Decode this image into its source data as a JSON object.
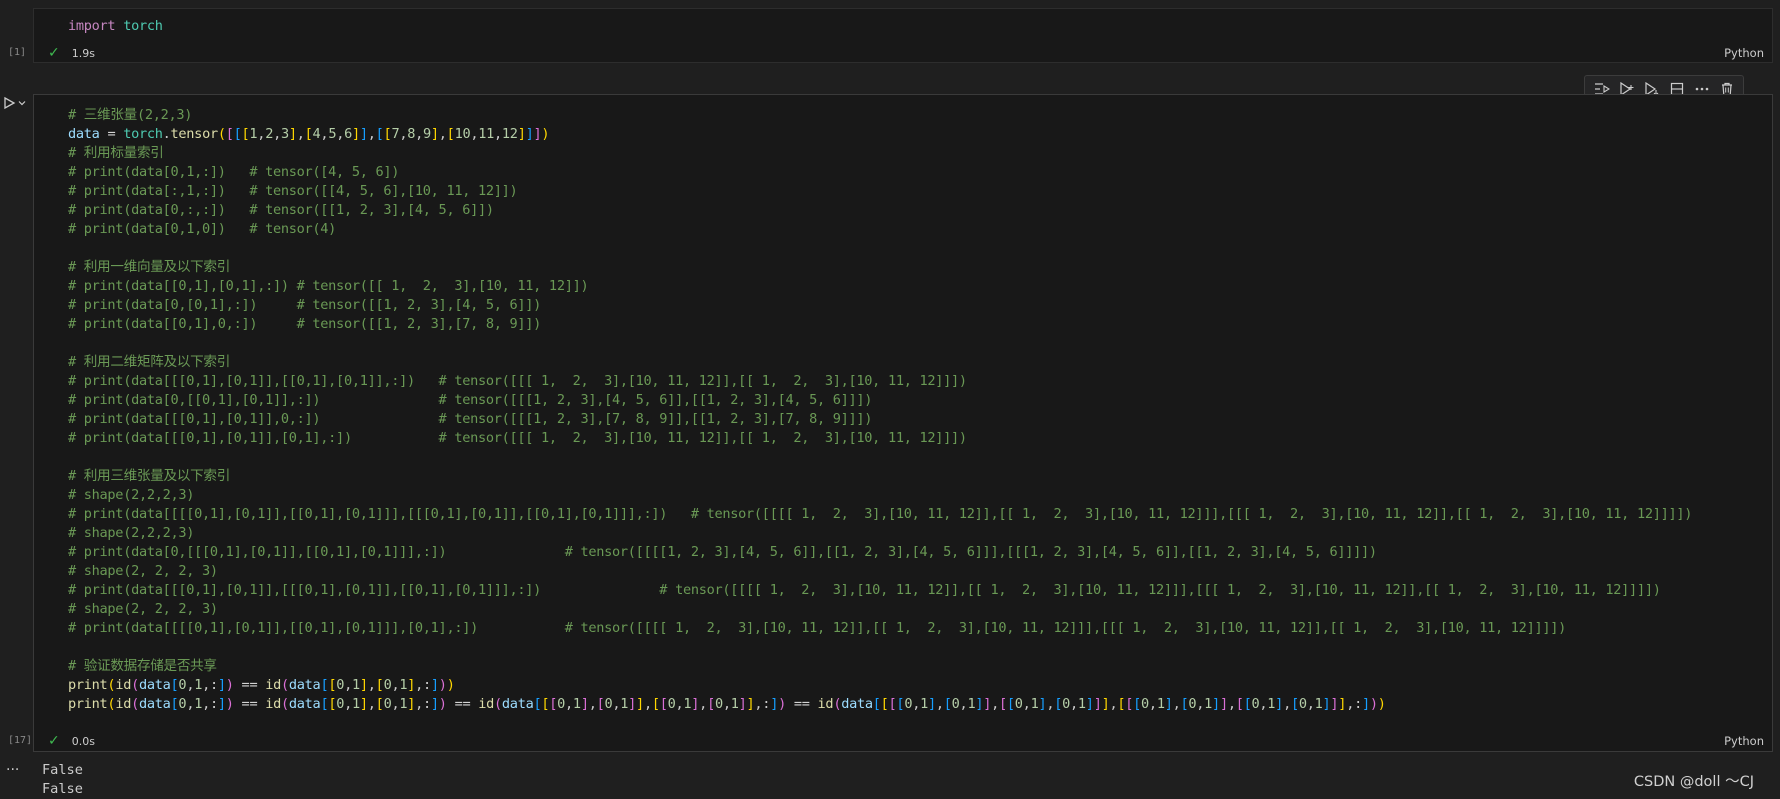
{
  "cell1": {
    "exec_count": "[1]",
    "status_time": "1.9s",
    "language": "Python",
    "code": {
      "kw": "import",
      "module": "torch"
    }
  },
  "cell2": {
    "exec_count": "[17]",
    "status_time": "0.0s",
    "language": "Python",
    "toolbar": [
      "execute-above-icon",
      "run-below-icon",
      "run-cell-icon",
      "split-cell-icon",
      "more-actions-icon",
      "delete-icon"
    ],
    "lines": [
      "# 三维张量(2,2,3)",
      "data = torch.tensor([[[1,2,3],[4,5,6]],[[7,8,9],[10,11,12]]])",
      "# 利用标量索引",
      "# print(data[0,1,:])   # tensor([4, 5, 6])",
      "# print(data[:,1,:])   # tensor([[4, 5, 6],[10, 11, 12]])",
      "# print(data[0,:,:])   # tensor([[1, 2, 3],[4, 5, 6]])",
      "# print(data[0,1,0])   # tensor(4)",
      "",
      "# 利用一维向量及以下索引",
      "# print(data[[0,1],[0,1],:]) # tensor([[ 1,  2,  3],[10, 11, 12]])",
      "# print(data[0,[0,1],:])     # tensor([[1, 2, 3],[4, 5, 6]])",
      "# print(data[[0,1],0,:])     # tensor([[1, 2, 3],[7, 8, 9]])",
      "",
      "# 利用二维矩阵及以下索引",
      "# print(data[[[0,1],[0,1]],[[0,1],[0,1]],:])   # tensor([[[ 1,  2,  3],[10, 11, 12]],[[ 1,  2,  3],[10, 11, 12]]])",
      "# print(data[0,[[0,1],[0,1]],:])               # tensor([[[1, 2, 3],[4, 5, 6]],[[1, 2, 3],[4, 5, 6]]])",
      "# print(data[[[0,1],[0,1]],0,:])               # tensor([[[1, 2, 3],[7, 8, 9]],[[1, 2, 3],[7, 8, 9]]])",
      "# print(data[[[0,1],[0,1]],[0,1],:])           # tensor([[[ 1,  2,  3],[10, 11, 12]],[[ 1,  2,  3],[10, 11, 12]]])",
      "",
      "# 利用三维张量及以下索引",
      "# shape(2,2,2,3)",
      "# print(data[[[[0,1],[0,1]],[[0,1],[0,1]]],[[[0,1],[0,1]],[[0,1],[0,1]]],:])   # tensor([[[[ 1,  2,  3],[10, 11, 12]],[[ 1,  2,  3],[10, 11, 12]]],[[[ 1,  2,  3],[10, 11, 12]],[[ 1,  2,  3],[10, 11, 12]]]])",
      "# shape(2,2,2,3)",
      "# print(data[0,[[[0,1],[0,1]],[[0,1],[0,1]]],:])               # tensor([[[[1, 2, 3],[4, 5, 6]],[[1, 2, 3],[4, 5, 6]]],[[[1, 2, 3],[4, 5, 6]],[[1, 2, 3],[4, 5, 6]]]])",
      "# shape(2, 2, 2, 3)",
      "# print(data[[[0,1],[0,1]],[[[0,1],[0,1]],[[0,1],[0,1]]],:])               # tensor([[[[ 1,  2,  3],[10, 11, 12]],[[ 1,  2,  3],[10, 11, 12]]],[[[ 1,  2,  3],[10, 11, 12]],[[ 1,  2,  3],[10, 11, 12]]]])",
      "# shape(2, 2, 2, 3)",
      "# print(data[[[[0,1],[0,1]],[[0,1],[0,1]]],[0,1],:])           # tensor([[[[ 1,  2,  3],[10, 11, 12]],[[ 1,  2,  3],[10, 11, 12]]],[[[ 1,  2,  3],[10, 11, 12]],[[ 1,  2,  3],[10, 11, 12]]]])",
      "",
      "# 验证数据存储是否共享",
      "print(id(data[0,1,:]) == id(data[[0,1],[0,1],:]))",
      "print(id(data[0,1,:]) == id(data[[0,1],[0,1],:]) == id(data[[[0,1],[0,1]],[[0,1],[0,1]],:]) == id(data[[[[0,1],[0,1]],[[0,1],[0,1]]],[[[0,1],[0,1]],[[0,1],[0,1]]],:]))"
    ]
  },
  "output": [
    "False",
    "False"
  ],
  "output_menu": "...",
  "watermark": "CSDN @doll ～CJ",
  "colors": {
    "background": "#1f1f1f",
    "cell_bg": "#181818",
    "comment": "#6a9955",
    "success_check": "#3fb950"
  }
}
